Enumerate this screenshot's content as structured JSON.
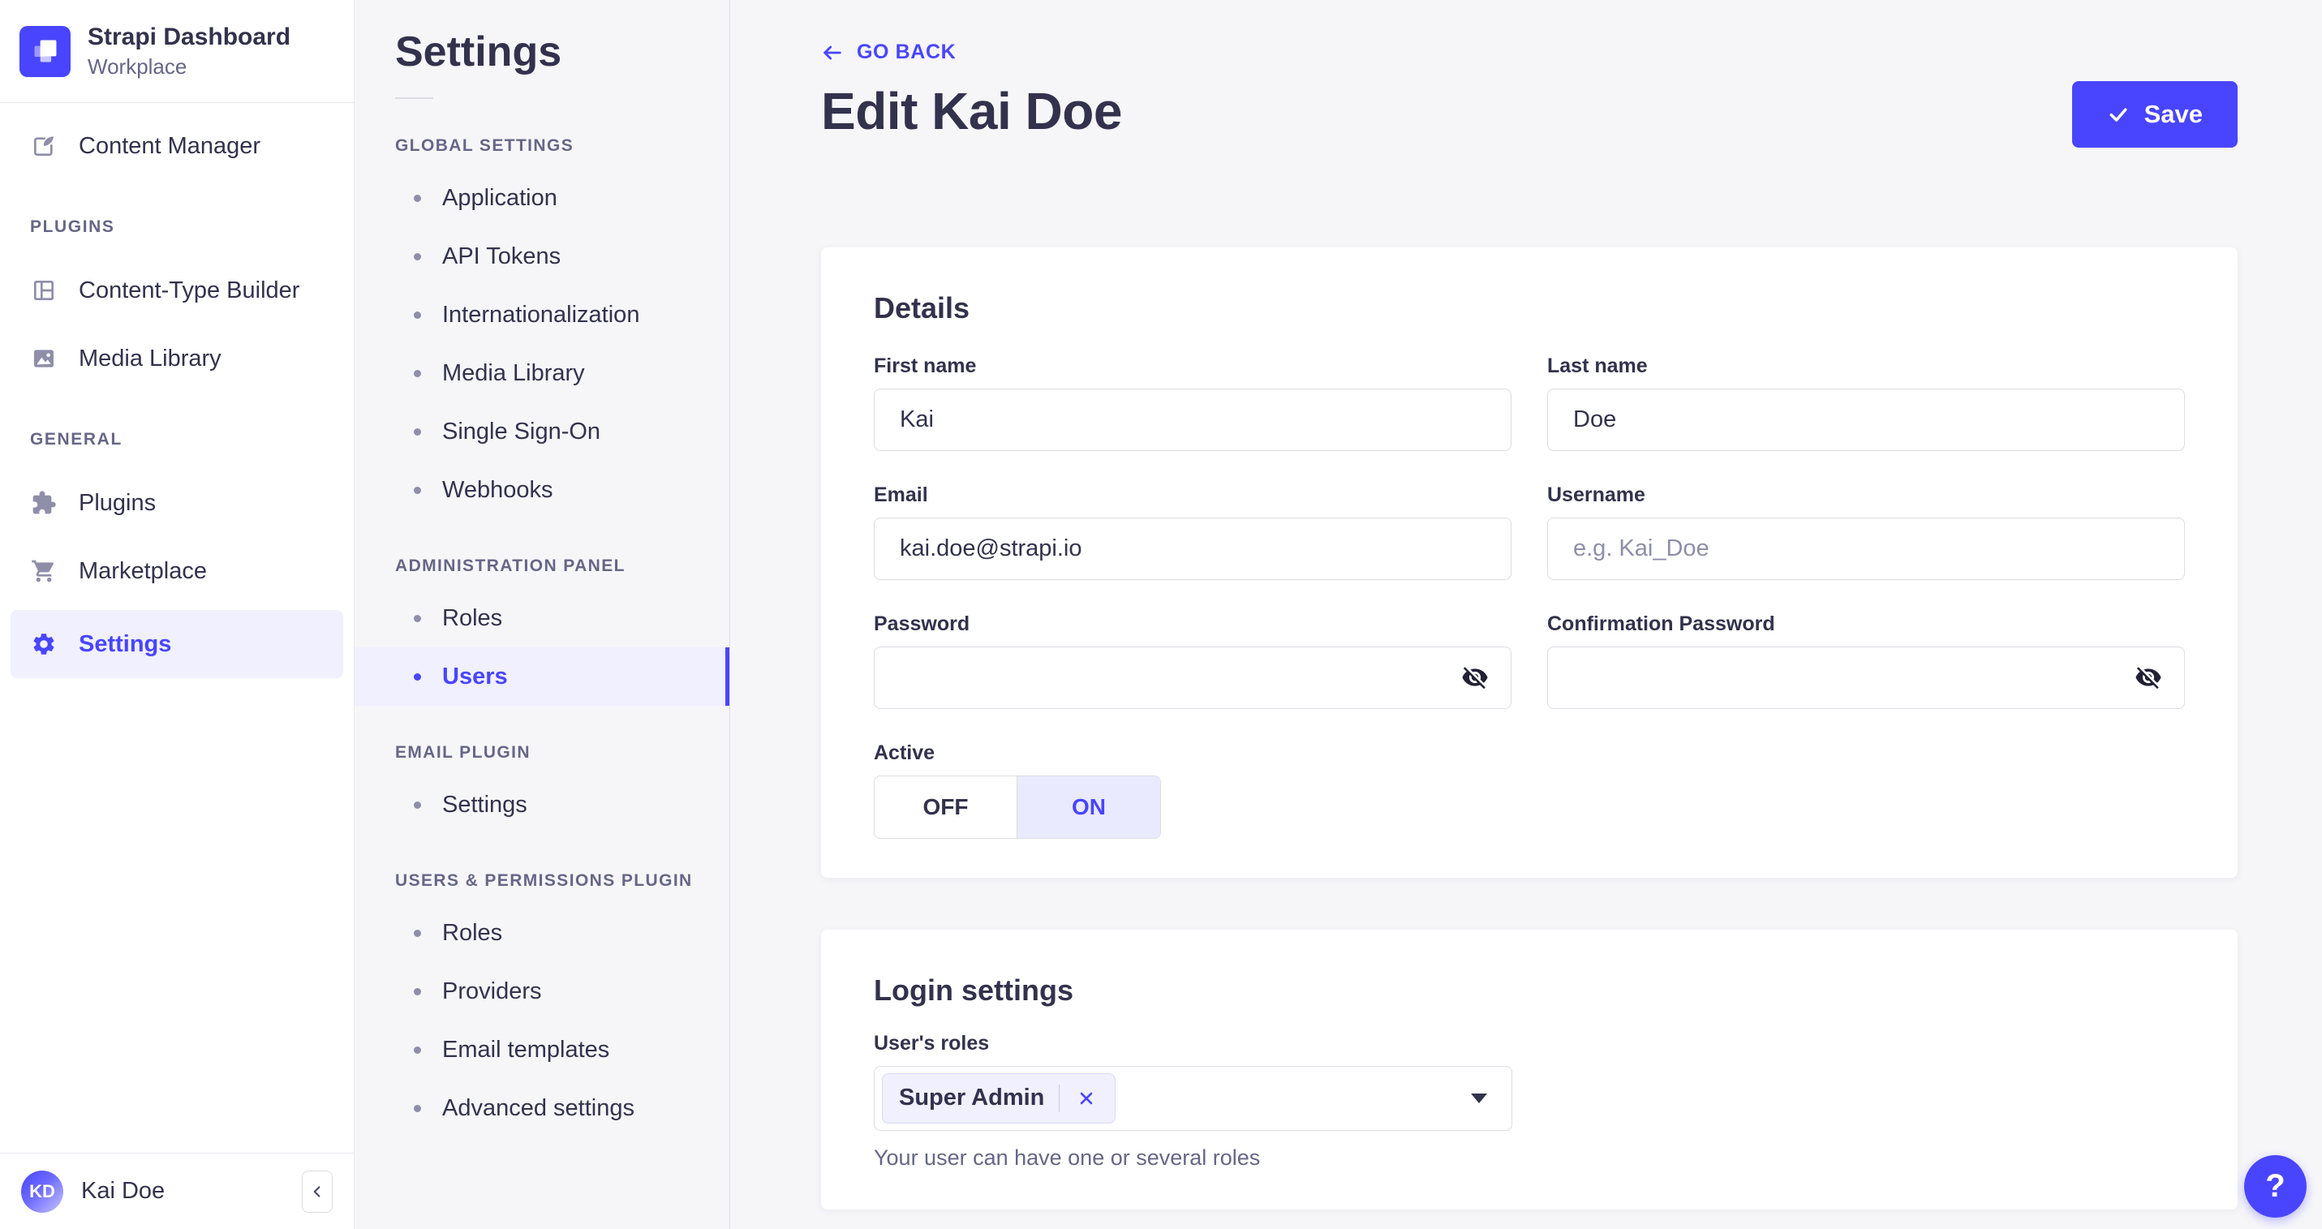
{
  "colors": {
    "primary": "#4945FF",
    "primary_light": "#F0F0FF",
    "text_dark": "#32324D",
    "text_muted": "#666687",
    "border": "#DCDCE4",
    "panel_bg": "#F6F6F9"
  },
  "brand": {
    "title": "Strapi Dashboard",
    "subtitle": "Workplace"
  },
  "sidebar": {
    "top_item": {
      "label": "Content Manager",
      "icon": "feather-pen-icon"
    },
    "sections": [
      {
        "label": "PLUGINS",
        "items": [
          {
            "label": "Content-Type Builder",
            "icon": "layout-icon"
          },
          {
            "label": "Media Library",
            "icon": "image-icon"
          }
        ]
      },
      {
        "label": "GENERAL",
        "items": [
          {
            "label": "Plugins",
            "icon": "puzzle-icon"
          },
          {
            "label": "Marketplace",
            "icon": "cart-icon"
          },
          {
            "label": "Settings",
            "icon": "gear-icon",
            "active": true
          }
        ]
      }
    ],
    "user": {
      "initials": "KD",
      "name": "Kai Doe"
    }
  },
  "settings_nav": {
    "title": "Settings",
    "sections": [
      {
        "label": "GLOBAL SETTINGS",
        "items": [
          {
            "label": "Application"
          },
          {
            "label": "API Tokens"
          },
          {
            "label": "Internationalization"
          },
          {
            "label": "Media Library"
          },
          {
            "label": "Single Sign-On"
          },
          {
            "label": "Webhooks"
          }
        ]
      },
      {
        "label": "ADMINISTRATION PANEL",
        "items": [
          {
            "label": "Roles"
          },
          {
            "label": "Users",
            "active": true
          }
        ]
      },
      {
        "label": "EMAIL PLUGIN",
        "items": [
          {
            "label": "Settings"
          }
        ]
      },
      {
        "label": "USERS & PERMISSIONS PLUGIN",
        "items": [
          {
            "label": "Roles"
          },
          {
            "label": "Providers"
          },
          {
            "label": "Email templates"
          },
          {
            "label": "Advanced settings"
          }
        ]
      }
    ]
  },
  "header": {
    "back_label": "GO BACK",
    "title": "Edit Kai Doe",
    "save_label": "Save"
  },
  "details": {
    "heading": "Details",
    "fields": {
      "first_name": {
        "label": "First name",
        "value": "Kai"
      },
      "last_name": {
        "label": "Last name",
        "value": "Doe"
      },
      "email": {
        "label": "Email",
        "value": "kai.doe@strapi.io"
      },
      "username": {
        "label": "Username",
        "placeholder": "e.g. Kai_Doe"
      },
      "password": {
        "label": "Password"
      },
      "confirmation_password": {
        "label": "Confirmation Password"
      }
    },
    "active_toggle": {
      "label": "Active",
      "off_label": "OFF",
      "on_label": "ON",
      "value": "ON"
    }
  },
  "login_settings": {
    "heading": "Login settings",
    "roles_label": "User's roles",
    "selected_roles": [
      "Super Admin"
    ],
    "helper": "Your user can have one or several roles"
  },
  "help": {
    "label": "?"
  }
}
